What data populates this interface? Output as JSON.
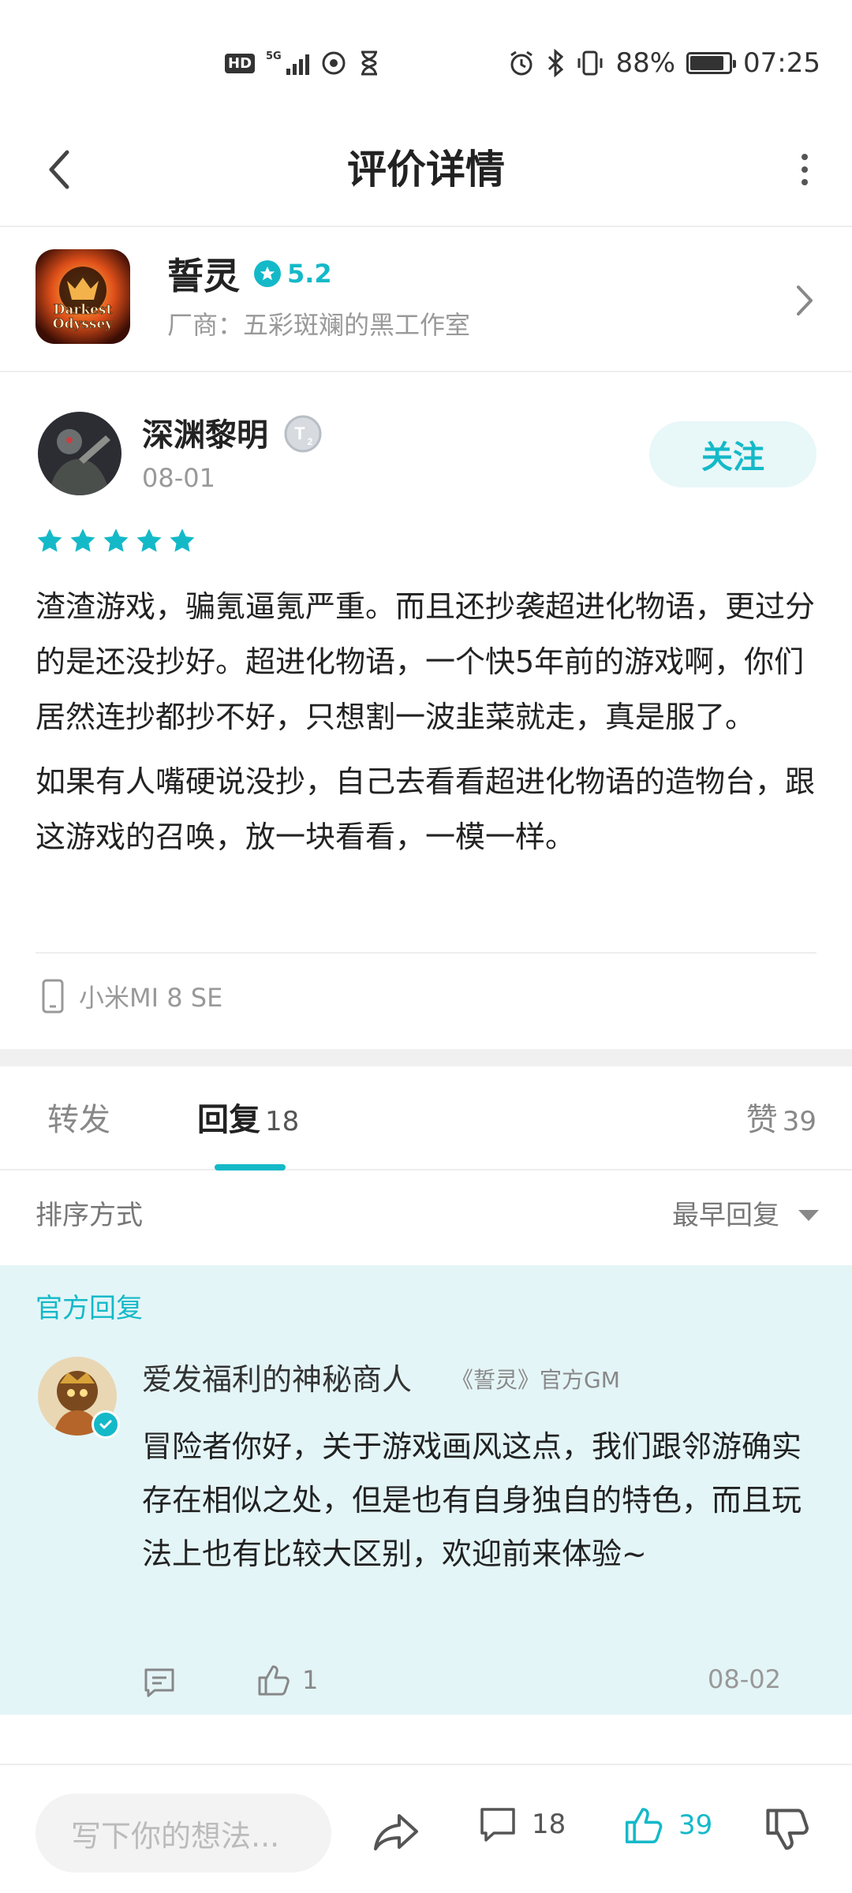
{
  "status_bar": {
    "battery_percent": "88%",
    "battery_level": 0.88,
    "time": "07:25",
    "network": "5G",
    "hd_label": "HD"
  },
  "nav": {
    "title": "评价详情",
    "back_icon": "chevron-left-icon",
    "more_icon": "more-vertical-icon"
  },
  "game": {
    "name": "誓灵",
    "rating": "5.2",
    "vendor": "厂商：五彩斑斓的黑工作室",
    "icon_text": "Darkest Odyssey"
  },
  "review": {
    "username": "深渊黎明",
    "date": "08-01",
    "follow_label": "关注",
    "stars": 5,
    "paragraphs": [
      "渣渣游戏，骗氪逼氪严重。而且还抄袭超进化物语，更过分的是还没抄好。超进化物语，一个快5年前的游戏啊，你们居然连抄都抄不好，只想割一波韭菜就走，真是服了。",
      "如果有人嘴硬说没抄，自己去看看超进化物语的造物台，跟这游戏的召唤，放一块看看，一模一样。"
    ],
    "device": "小米MI 8 SE"
  },
  "tabs": {
    "forward": "转发",
    "reply": "回复",
    "reply_count": "18",
    "likes": "赞",
    "likes_count": "39"
  },
  "sort": {
    "label": "排序方式",
    "selected": "最早回复"
  },
  "official_reply": {
    "section_label": "官方回复",
    "name": "爱发福利的神秘商人",
    "tag": "《誓灵》官方GM",
    "body": "冒险者你好，关于游戏画风这点，我们跟邻游确实存在相似之处，但是也有自身独自的特色，而且玩法上也有比较大区别，欢迎前来体验~",
    "like_count": "1",
    "date": "08-02"
  },
  "bottom_bar": {
    "input_placeholder": "写下你的想法...",
    "comment_count": "18",
    "like_count": "39"
  },
  "colors": {
    "accent": "#14b9c8",
    "official_bg": "#e4f5f7",
    "star": "#14b9c8"
  }
}
